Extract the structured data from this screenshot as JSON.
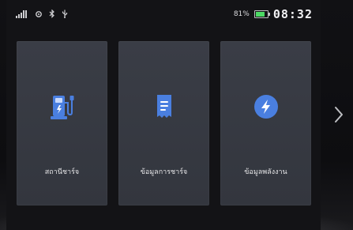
{
  "status": {
    "battery_percent": "81%",
    "battery_level": 0.81,
    "time": "08:32"
  },
  "cards": [
    {
      "label": "สถานีชาร์จ",
      "icon": "charging-station-icon"
    },
    {
      "label": "ข้อมูลการชาร์จ",
      "icon": "receipt-icon"
    },
    {
      "label": "ข้อมูลพลังงาน",
      "icon": "lightning-bolt-icon"
    }
  ],
  "colors": {
    "accent_blue": "#4a7fe0",
    "card_bg": "#3a3d46",
    "battery_green": "#4cd964"
  },
  "navigation": {
    "next_icon": "chevron-right-icon"
  }
}
